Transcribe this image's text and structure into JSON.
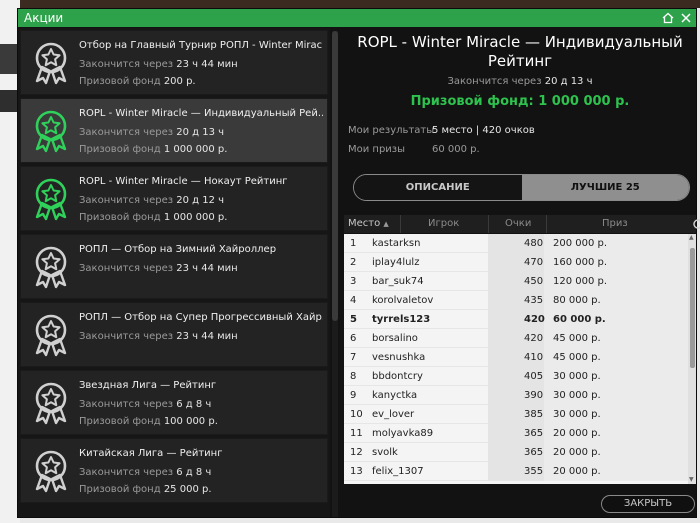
{
  "window": {
    "title": "Акции"
  },
  "promos": [
    {
      "title": "Отбор на Главный Турнир РОПЛ - Winter Miracle",
      "ends_label": "Закончится через",
      "ends": "23 ч 44 мин",
      "prize_label": "Призовой фонд",
      "prize": "200 р.",
      "selected": false
    },
    {
      "title": "ROPL - Winter Miracle — Индивидуальный Рей...",
      "ends_label": "Закончится через",
      "ends": "20 д 13 ч",
      "prize_label": "Призовой фонд",
      "prize": "1 000 000 р.",
      "selected": true
    },
    {
      "title": "ROPL - Winter Miracle — Нокаут Рейтинг",
      "ends_label": "Закончится через",
      "ends": "20 д 12 ч",
      "prize_label": "Призовой фонд",
      "prize": "1 000 000 р.",
      "selected": false
    },
    {
      "title": "РОПЛ — Отбор на Зимний Хайроллер",
      "ends_label": "Закончится через",
      "ends": "23 ч 44 мин",
      "prize_label": "",
      "prize": "",
      "selected": false
    },
    {
      "title": "РОПЛ — Отбор на Супер Прогрессивный Хайр...",
      "ends_label": "Закончится через",
      "ends": "23 ч 44 мин",
      "prize_label": "",
      "prize": "",
      "selected": false
    },
    {
      "title": "Звездная Лига — Рейтинг",
      "ends_label": "Закончится через",
      "ends": "6 д 8 ч",
      "prize_label": "Призовой фонд",
      "prize": "100 000 р.",
      "selected": false
    },
    {
      "title": "Китайская Лига — Рейтинг",
      "ends_label": "Закончится через",
      "ends": "6 д 8 ч",
      "prize_label": "Призовой фонд",
      "prize": "25 000 р.",
      "selected": false
    }
  ],
  "detail": {
    "title_line1": "ROPL - Winter Miracle — Индивидуальный",
    "title_line2": "Рейтинг",
    "ends_label": "Закончится через",
    "ends": "20 д 13 ч",
    "prize": "Призовой фонд: 1 000 000 р.",
    "my_results_label": "Мои результаты",
    "my_results": "5 место | 420 очков",
    "my_prizes_label": "Мои призы",
    "my_prizes": "60 000 р.",
    "tab_description": "ОПИСАНИЕ",
    "tab_top": "ЛУЧШИЕ 25",
    "close_label": "ЗАКРЫТЬ"
  },
  "table": {
    "headers": {
      "place": "Место",
      "player": "Игрок",
      "points": "Очки",
      "prize": "Приз"
    },
    "sort_indicator": "▲",
    "rows": [
      {
        "place": "1",
        "player": "kastarksn",
        "points": "480",
        "prize": "200 000 р."
      },
      {
        "place": "2",
        "player": "iplay4lulz",
        "points": "470",
        "prize": "160 000 р."
      },
      {
        "place": "3",
        "player": "bar_suk74",
        "points": "450",
        "prize": "120 000 р."
      },
      {
        "place": "4",
        "player": "korolvaletov",
        "points": "435",
        "prize": "80 000 р."
      },
      {
        "place": "5",
        "player": "tyrrels123",
        "points": "420",
        "prize": "60 000 р.",
        "me": true
      },
      {
        "place": "6",
        "player": "borsalino",
        "points": "420",
        "prize": "45 000 р."
      },
      {
        "place": "7",
        "player": "vesnushka",
        "points": "410",
        "prize": "45 000 р."
      },
      {
        "place": "8",
        "player": "bbdontcry",
        "points": "405",
        "prize": "30 000 р."
      },
      {
        "place": "9",
        "player": "kanyctka",
        "points": "390",
        "prize": "30 000 р."
      },
      {
        "place": "10",
        "player": "ev_lover",
        "points": "385",
        "prize": "30 000 р."
      },
      {
        "place": "11",
        "player": "molyavka89",
        "points": "365",
        "prize": "20 000 р."
      },
      {
        "place": "12",
        "player": "svolk",
        "points": "365",
        "prize": "20 000 р."
      },
      {
        "place": "13",
        "player": "felix_1307",
        "points": "355",
        "prize": "20 000 р."
      }
    ]
  },
  "colors": {
    "accent": "#2ea24b",
    "prize_green": "#2ec24e",
    "badge_green": "#2fd15a",
    "badge_grey": "#d0d0d0"
  },
  "icons": {
    "promo_badge": "award-ribbon-icon",
    "refresh": "refresh-icon",
    "home": "home-icon",
    "close": "close-icon"
  }
}
